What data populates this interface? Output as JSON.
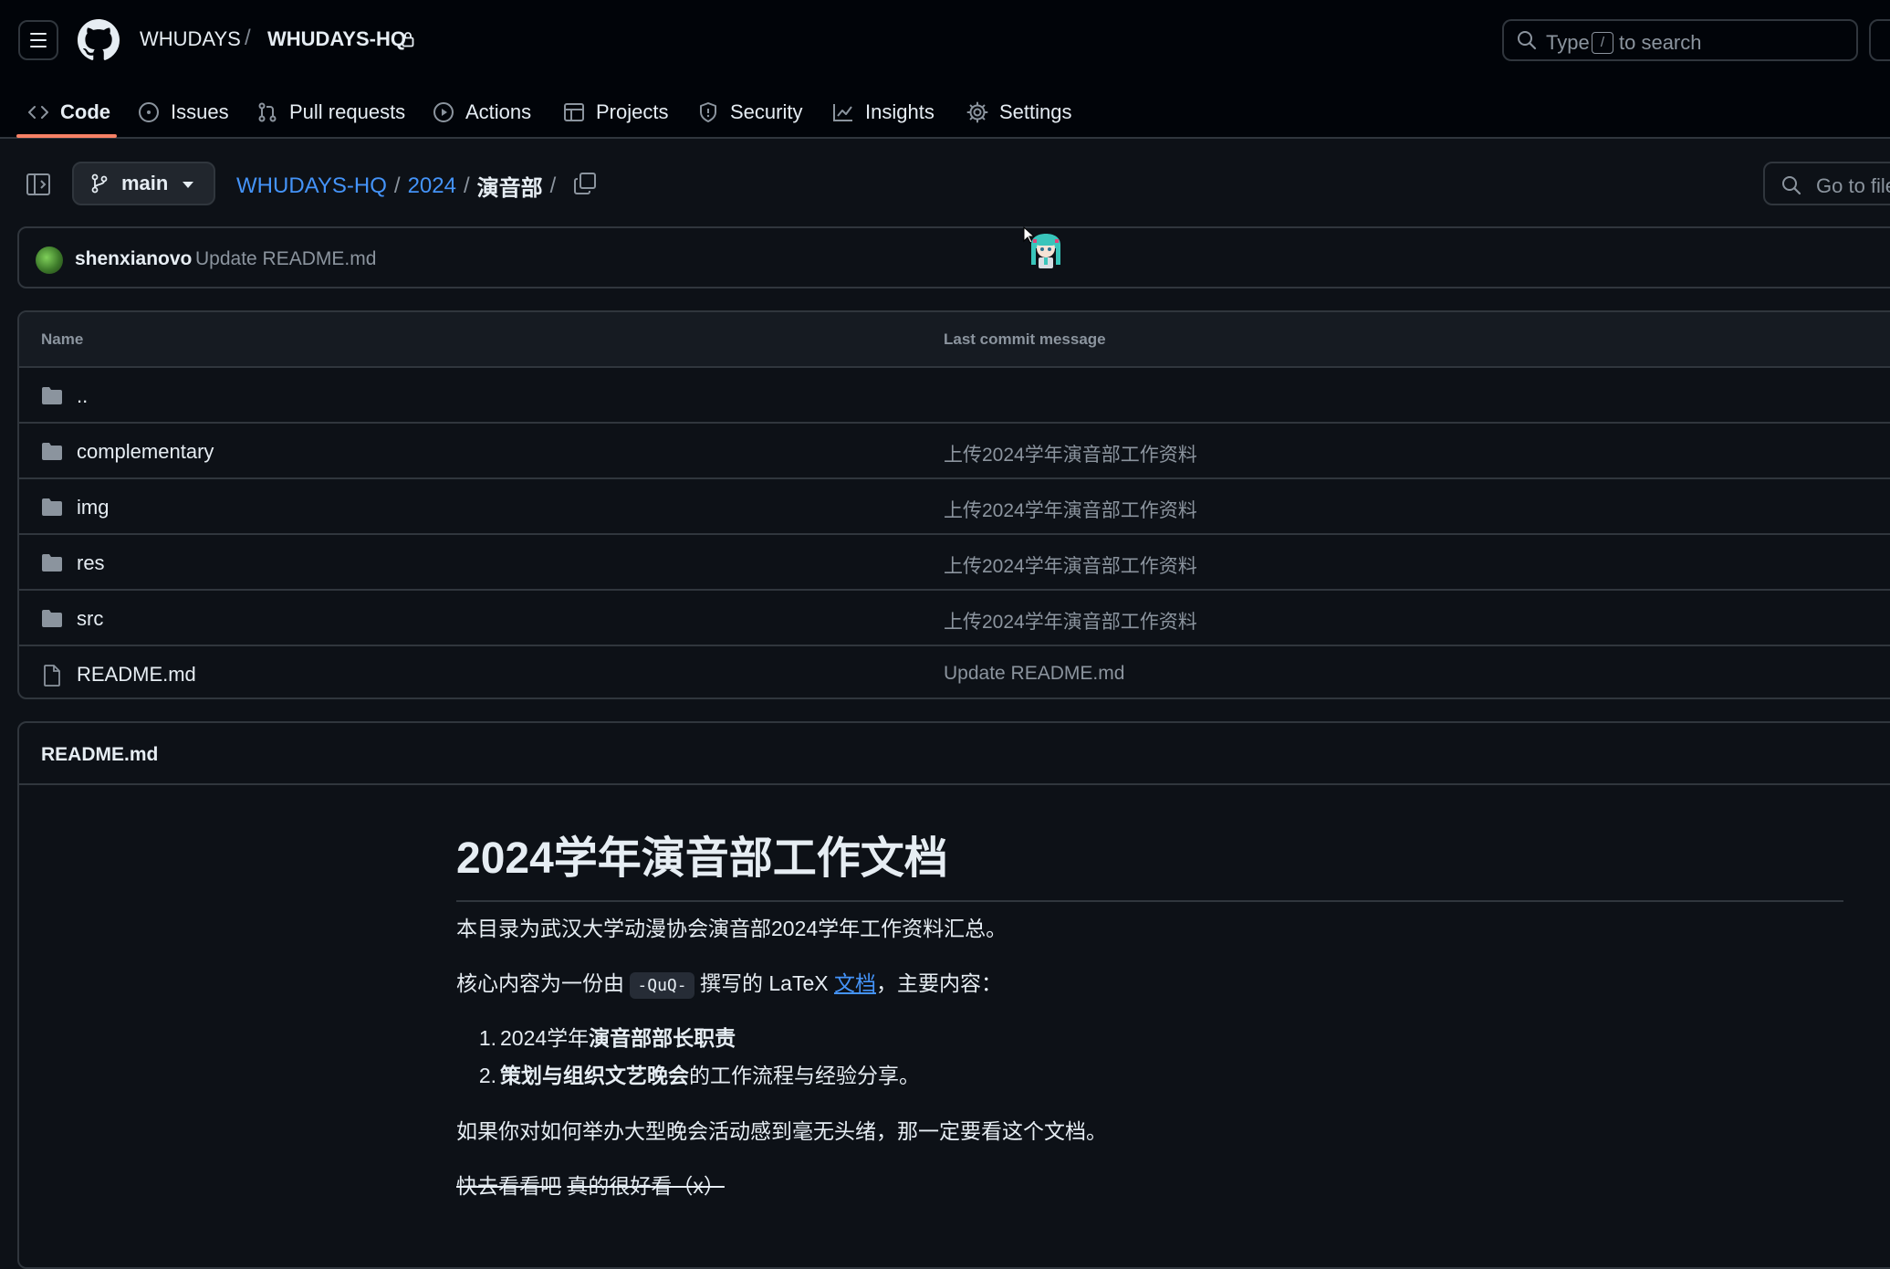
{
  "header": {
    "owner": "WHUDAYS",
    "separator": "/",
    "repo": "WHUDAYS-HQ",
    "search": {
      "before_key": "Type",
      "key": "/",
      "after_key": "to search"
    }
  },
  "tabs": [
    {
      "label": "Code",
      "icon": "code-icon",
      "active": true
    },
    {
      "label": "Issues",
      "icon": "issue-opened-icon"
    },
    {
      "label": "Pull requests",
      "icon": "git-pull-request-icon"
    },
    {
      "label": "Actions",
      "icon": "play-icon"
    },
    {
      "label": "Projects",
      "icon": "table-icon"
    },
    {
      "label": "Security",
      "icon": "shield-icon"
    },
    {
      "label": "Insights",
      "icon": "graph-icon"
    },
    {
      "label": "Settings",
      "icon": "gear-icon"
    }
  ],
  "toolbar": {
    "branch": "main",
    "breadcrumb": {
      "root": "WHUDAYS-HQ",
      "year": "2024",
      "current": "演音部",
      "sep": "/"
    },
    "goto_file": "Go to file"
  },
  "commit": {
    "author": "shenxianovo",
    "message": "Update README.md"
  },
  "files": {
    "headers": {
      "name": "Name",
      "last_commit": "Last commit message"
    },
    "rows": [
      {
        "type": "parent",
        "name": "..",
        "message": ""
      },
      {
        "type": "dir",
        "name": "complementary",
        "message": "上传2024学年演音部工作资料"
      },
      {
        "type": "dir",
        "name": "img",
        "message": "上传2024学年演音部工作资料"
      },
      {
        "type": "dir",
        "name": "res",
        "message": "上传2024学年演音部工作资料"
      },
      {
        "type": "dir",
        "name": "src",
        "message": "上传2024学年演音部工作资料"
      },
      {
        "type": "file",
        "name": "README.md",
        "message": "Update README.md"
      }
    ]
  },
  "readme": {
    "filename": "README.md",
    "title": "2024学年演音部工作文档",
    "p1": "本目录为武汉大学动漫协会演音部2024学年工作资料汇总。",
    "p2": {
      "before": "核心内容为一份由 ",
      "code": "-QuQ-",
      "middle": " 撰写的 LaTeX ",
      "link": "文档",
      "after": "，主要内容："
    },
    "list": [
      {
        "num": "1.",
        "plain": "2024学年",
        "bold": "演音部部长职责",
        "tail": ""
      },
      {
        "num": "2.",
        "plain": "",
        "bold": "策划与组织文艺晚会",
        "tail": "的工作流程与经验分享。"
      }
    ],
    "p3": "如果你对如何举办大型晚会活动感到毫无头绪，那一定要看这个文档。",
    "p4": {
      "plain": "快去看看吧",
      "strike": "真的很好看（x）"
    }
  }
}
